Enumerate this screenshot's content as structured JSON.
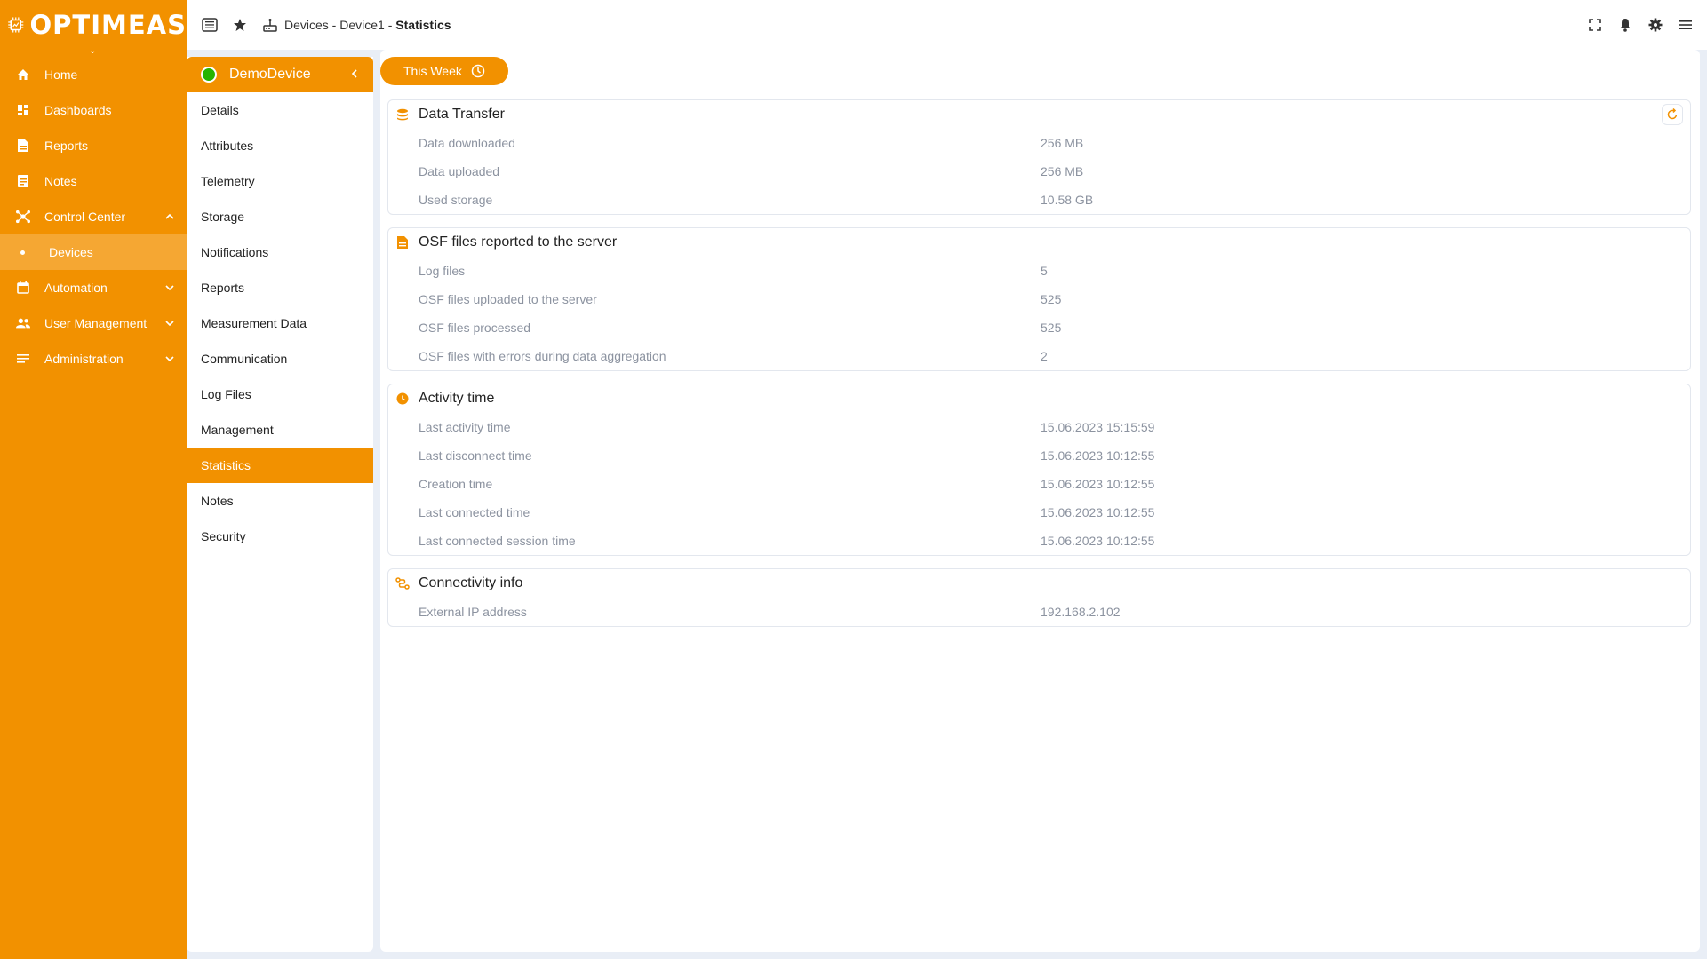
{
  "brand": {
    "name": "OPTIMEAS"
  },
  "sidebar": {
    "items": [
      {
        "label": "Home"
      },
      {
        "label": "Dashboards"
      },
      {
        "label": "Reports"
      },
      {
        "label": "Notes"
      },
      {
        "label": "Control Center"
      },
      {
        "label": "Devices"
      },
      {
        "label": "Automation"
      },
      {
        "label": "User Management"
      },
      {
        "label": "Administration"
      }
    ]
  },
  "breadcrumb": {
    "part1": "Devices",
    "sep1": " - ",
    "part2": "Device1",
    "sep2": " - ",
    "current": "Statistics"
  },
  "device": {
    "name": "DemoDevice",
    "status_color": "#27b400"
  },
  "subnav": {
    "items": [
      {
        "label": "Details"
      },
      {
        "label": "Attributes"
      },
      {
        "label": "Telemetry"
      },
      {
        "label": "Storage"
      },
      {
        "label": "Notifications"
      },
      {
        "label": "Reports"
      },
      {
        "label": "Measurement Data"
      },
      {
        "label": "Communication"
      },
      {
        "label": "Log Files"
      },
      {
        "label": "Management"
      },
      {
        "label": "Statistics"
      },
      {
        "label": "Notes"
      },
      {
        "label": "Security"
      }
    ]
  },
  "period": {
    "label": "This Week"
  },
  "sections": {
    "data_transfer": {
      "title": "Data Transfer",
      "rows": [
        {
          "label": "Data downloaded",
          "value": "256 MB"
        },
        {
          "label": "Data uploaded",
          "value": "256 MB"
        },
        {
          "label": "Used storage",
          "value": "10.58 GB"
        }
      ]
    },
    "osf": {
      "title": "OSF files reported to the server",
      "rows": [
        {
          "label": "Log files",
          "value": "5"
        },
        {
          "label": "OSF files uploaded to the server",
          "value": "525"
        },
        {
          "label": "OSF files processed",
          "value": "525"
        },
        {
          "label": "OSF files with errors during data aggregation",
          "value": "2"
        }
      ]
    },
    "activity": {
      "title": "Activity time",
      "rows": [
        {
          "label": "Last activity time",
          "value": "15.06.2023 15:15:59"
        },
        {
          "label": "Last disconnect time",
          "value": "15.06.2023 10:12:55"
        },
        {
          "label": "Creation time",
          "value": "15.06.2023 10:12:55"
        },
        {
          "label": "Last connected time",
          "value": "15.06.2023 10:12:55"
        },
        {
          "label": "Last connected session time",
          "value": "15.06.2023 10:12:55"
        }
      ]
    },
    "connectivity": {
      "title": "Connectivity info",
      "rows": [
        {
          "label": "External IP address",
          "value": "192.168.2.102"
        }
      ]
    }
  },
  "colors": {
    "accent": "#f29100",
    "accent_light": "#f5a733",
    "background": "#e9eef6"
  }
}
